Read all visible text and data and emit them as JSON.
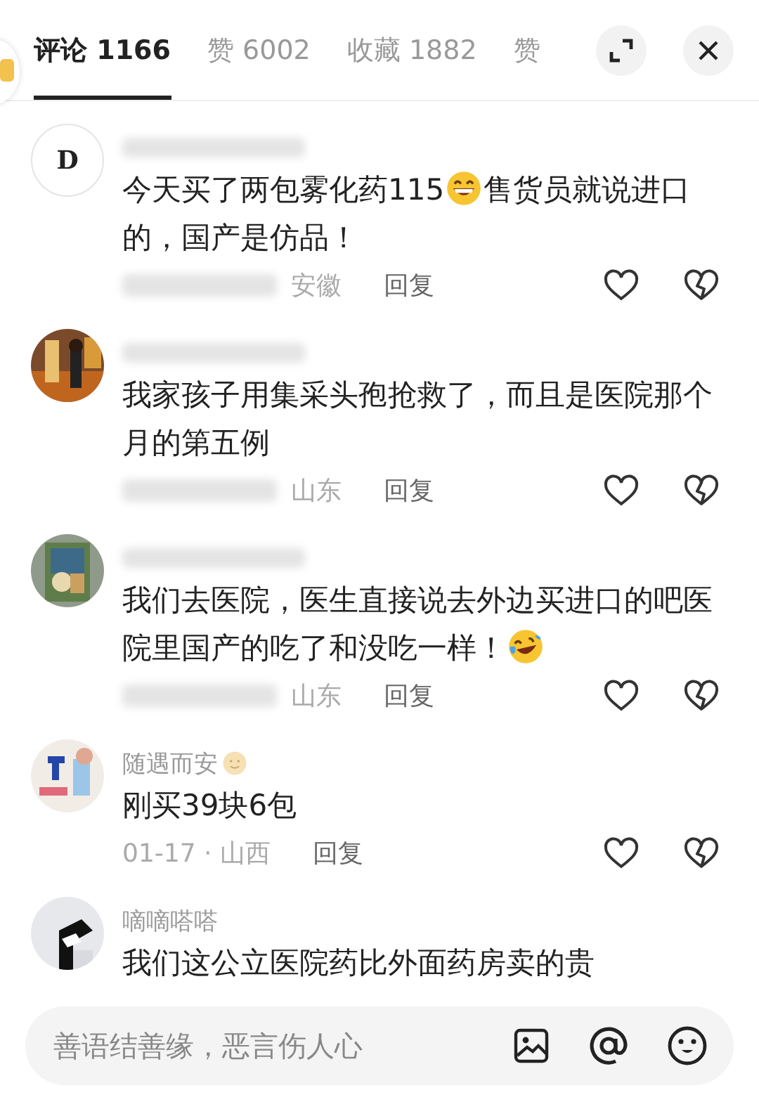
{
  "tabs": [
    {
      "label": "评论 1166",
      "selected": true
    },
    {
      "label": "赞 6002",
      "selected": false
    },
    {
      "label": "收藏 1882",
      "selected": false
    },
    {
      "label": "赞",
      "selected": false
    }
  ],
  "comments": [
    {
      "avatar": {
        "kind": "logo",
        "text": "D"
      },
      "segments": [
        {
          "kind": "text",
          "text": "今天买了两包雾化药115"
        },
        {
          "kind": "grin"
        },
        {
          "kind": "text",
          "text": "售货员就说进口"
        },
        {
          "kind": "text",
          "text": "的，国产是仿品！"
        }
      ],
      "meta": "安徽",
      "reply": "回复"
    },
    {
      "avatar": {
        "kind": "picture"
      },
      "segments": [
        {
          "kind": "text",
          "text": "我家孩子用集采头孢抢救了，而且是医院那个月的第五例"
        }
      ],
      "meta": "山东",
      "reply": "回复"
    },
    {
      "avatar": {
        "kind": "picture"
      },
      "segments": [
        {
          "kind": "text",
          "text": "我们去医院，医生直接说去外边买进口的吧医"
        },
        {
          "kind": "text",
          "text": "院里国产的吃了和没吃一样！"
        },
        {
          "kind": "laugh"
        }
      ],
      "meta": "山东",
      "reply": "回复"
    },
    {
      "avatar": {
        "kind": "picture"
      },
      "name": [
        {
          "kind": "text",
          "text": "随遇而安"
        },
        {
          "kind": "smile"
        }
      ],
      "segments": [
        {
          "kind": "text",
          "text": "刚买39块6包"
        }
      ],
      "meta": "01-17 · 山西",
      "reply": "回复"
    },
    {
      "avatar": {
        "kind": "picture"
      },
      "name": [
        {
          "kind": "text",
          "text": "嘀嘀嗒嗒"
        }
      ],
      "segments": [
        {
          "kind": "text",
          "text": "我们这公立医院药比外面药房卖的贵"
        }
      ]
    }
  ],
  "input": {
    "placeholder": "善语结善缘，恶言伤人心"
  }
}
